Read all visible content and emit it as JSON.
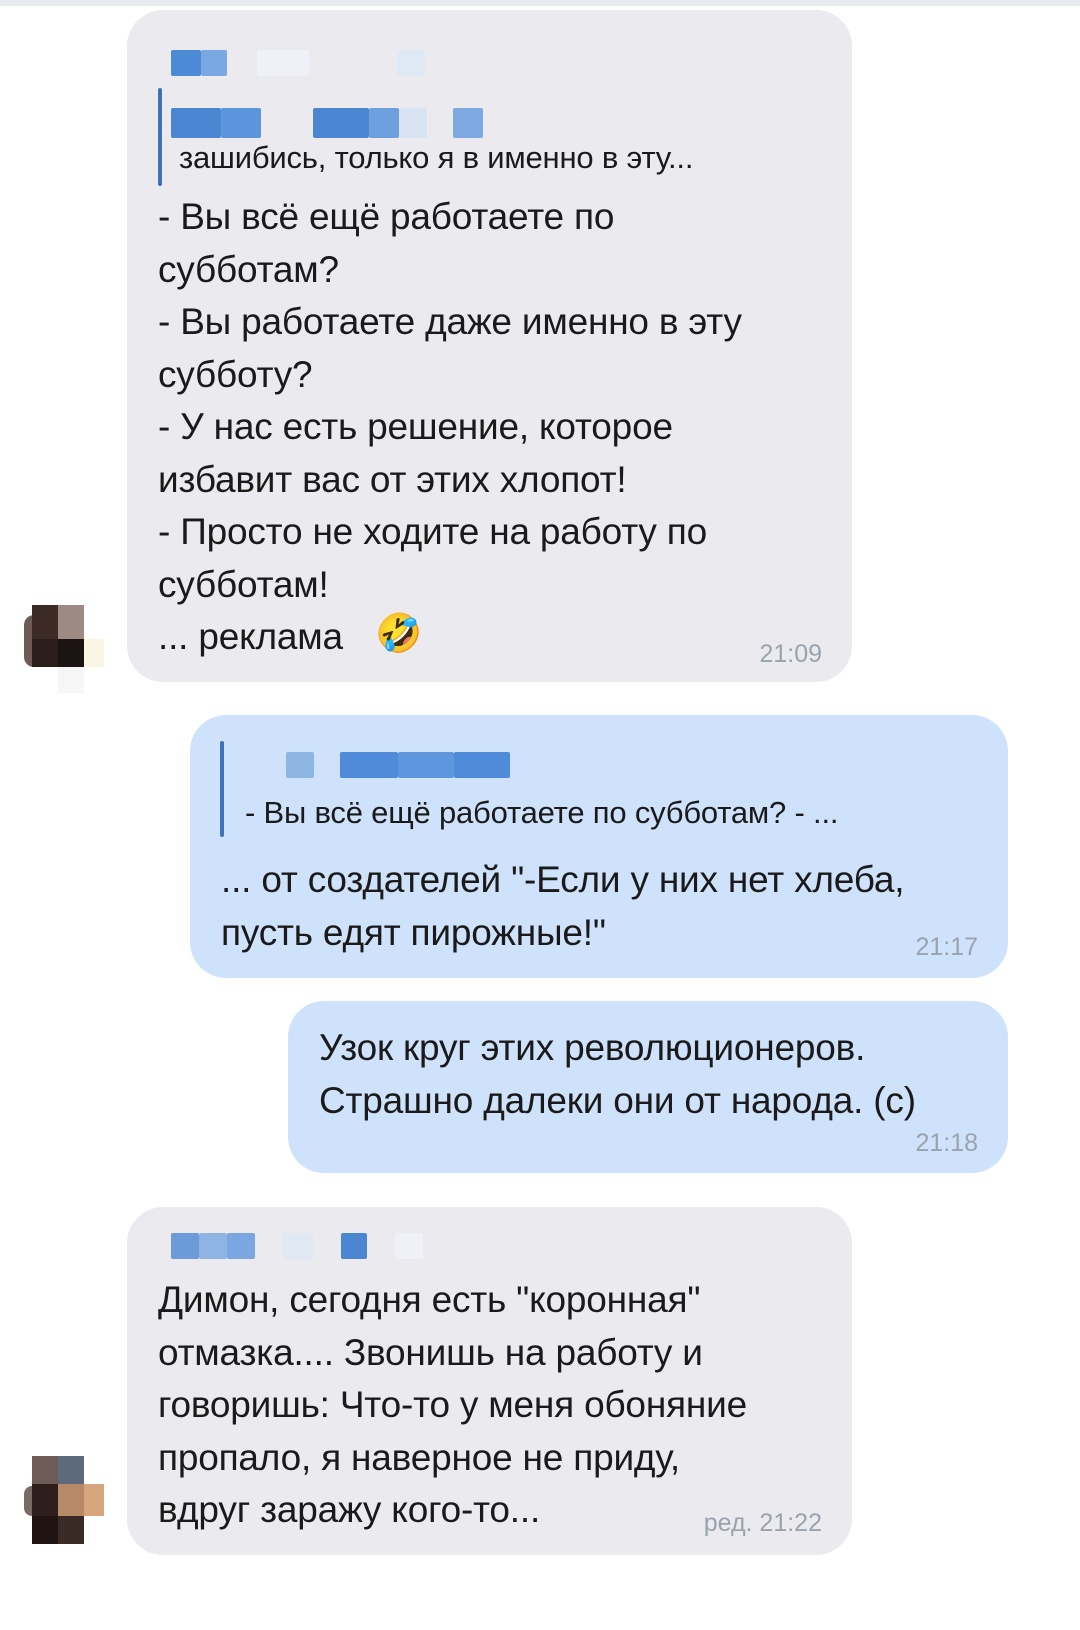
{
  "messages": [
    {
      "id": "m1",
      "direction": "incoming",
      "quote_text": "зашибись, только я в именно в эту...",
      "body": "- Вы всё ещё работаете по\nсубботам?\n- Вы работаете даже именно в эту\nсубботу?\n- У нас есть решение, которое\nизбавит вас от этих хлопот!\n- Просто не ходите на работу по\nсубботам!\n... реклама",
      "emoji": "🤣",
      "time": "21:09"
    },
    {
      "id": "m2",
      "direction": "outgoing",
      "quote_text": "- Вы всё ещё работаете по субботам? - ...",
      "body": "... от создателей \"-Если у них нет хлеба,\nпусть едят пирожные!\"",
      "time": "21:17"
    },
    {
      "id": "m3",
      "direction": "outgoing",
      "body": "Узок круг этих революционеров.\nСтрашно далеки они от народа. (с)",
      "time": "21:18"
    },
    {
      "id": "m4",
      "direction": "incoming",
      "body": "Димон, сегодня есть \"коронная\"\nотмазка.... Звонишь на работу и\nговоришь: Что-то у меня обоняние\nпропало, я наверное не приду,\nвдруг заражу кого-то...",
      "time": "ред. 21:22"
    }
  ],
  "colors": {
    "incoming_bubble": "#ebebef",
    "outgoing_bubble": "#cfe2fb",
    "accent": "#3f73b9",
    "time_text": "#9aa3ad"
  },
  "icons": {
    "emoji": "rolling-on-floor-laughing"
  }
}
